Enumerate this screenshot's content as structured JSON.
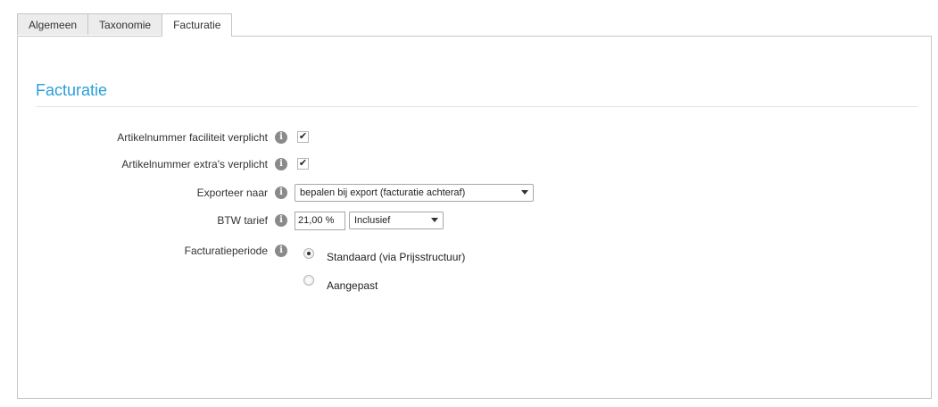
{
  "tabs": [
    {
      "label": "Algemeen"
    },
    {
      "label": "Taxonomie"
    },
    {
      "label": "Facturatie"
    }
  ],
  "section": {
    "title": "Facturatie"
  },
  "fields": {
    "artikelnummer_faciliteit": {
      "label": "Artikelnummer faciliteit verplicht",
      "checked": true
    },
    "artikelnummer_extras": {
      "label": "Artikelnummer extra's verplicht",
      "checked": true
    },
    "exporteer_naar": {
      "label": "Exporteer naar",
      "selected": "bepalen bij export (facturatie achteraf)"
    },
    "btw_tarief": {
      "label": "BTW tarief",
      "value": "21,00 %",
      "mode": "Inclusief"
    },
    "facturatieperiode": {
      "label": "Facturatieperiode",
      "options": [
        {
          "label": "Standaard (via Prijsstructuur)",
          "checked": true
        },
        {
          "label": "Aangepast",
          "checked": false
        }
      ]
    }
  },
  "icons": {
    "info": "info-icon",
    "check": "checkmark-icon",
    "dropdown": "chevron-down-icon"
  },
  "colors": {
    "accent": "#2a9fd8",
    "border": "#c6c6c6"
  }
}
